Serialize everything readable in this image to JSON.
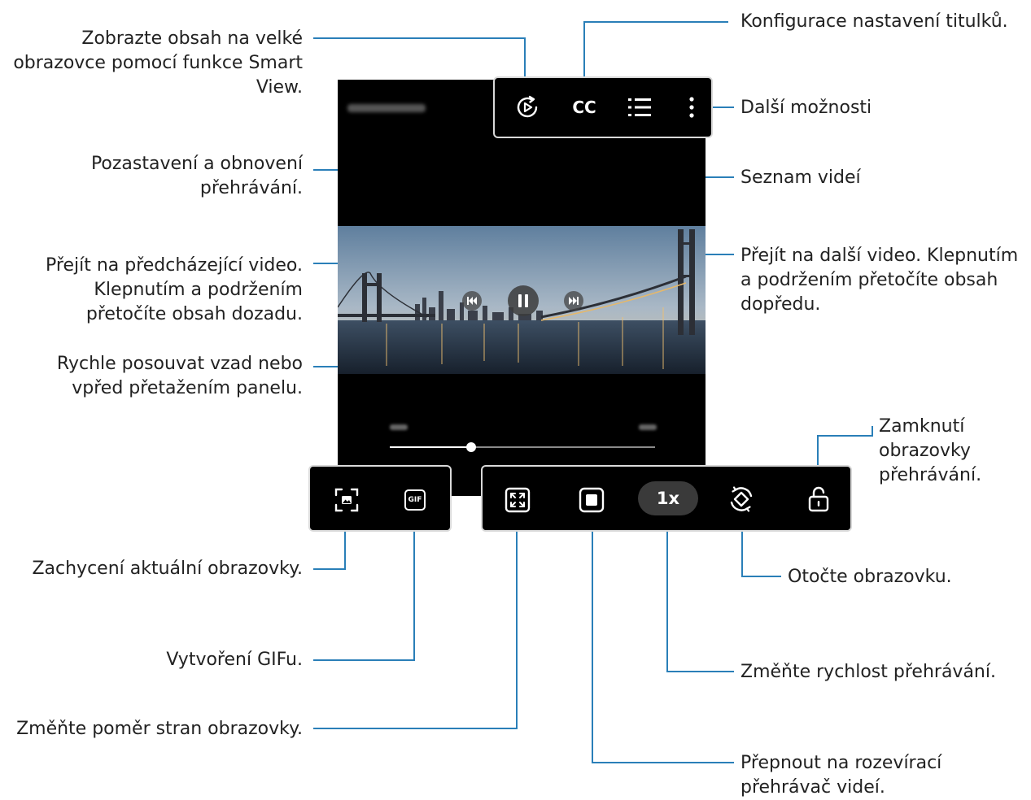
{
  "labels": {
    "smart_view": "Zobrazte obsah na velké\nobrazovce pomocí funkce Smart\nView.",
    "subtitles": "Konfigurace nastavení titulků.",
    "more_options": "Další možnosti",
    "video_list": "Seznam videí",
    "pause_resume": "Pozastavení a obnovení\npřehrávání.",
    "previous_video": "Přejít na předcházející video.\nKlepnutím a podržením\npřetočíte obsah dozadu.",
    "next_video": "Přejít na další video. Klepnutím\na podržením přetočíte obsah\ndopředu.",
    "seek_bar": "Rychle posouvat vzad nebo\nvpřed přetažením panelu.",
    "lock_screen": "Zamknutí\nobrazovky\npřehrávání.",
    "capture": "Zachycení aktuální obrazovky.",
    "rotate": "Otočte obrazovku.",
    "gif": "Vytvoření GIFu.",
    "speed": "Změňte rychlost přehrávání.",
    "aspect_ratio": "Změňte poměr stran obrazovky.",
    "popup_player": "Přepnout na rozevírací\npřehrávač videí."
  },
  "buttons": {
    "cc": "CC",
    "gif": "GIF",
    "speed": "1x"
  },
  "colors": {
    "callout_line": "#2a7fb8",
    "player_bg": "#000000",
    "bar_border": "#d9d9d9"
  }
}
